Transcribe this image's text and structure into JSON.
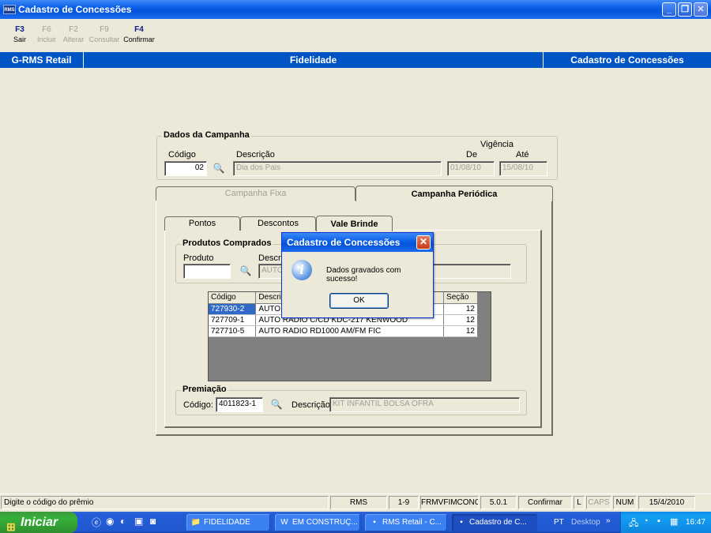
{
  "window": {
    "title": "Cadastro de Concessões",
    "app_icon": "RMS"
  },
  "toolbar": [
    {
      "key": "F3",
      "label": "Sair",
      "enabled": true
    },
    {
      "key": "F6",
      "label": "Incluir",
      "enabled": false
    },
    {
      "key": "F2",
      "label": "Alterar",
      "enabled": false
    },
    {
      "key": "F9",
      "label": "Consultar",
      "enabled": false
    },
    {
      "key": "F4",
      "label": "Confirmar",
      "enabled": true
    }
  ],
  "header": {
    "left": "G-RMS Retail",
    "center": "Fidelidade",
    "right": "Cadastro de Concessões"
  },
  "campanha": {
    "legend": "Dados da Campanha",
    "codigo_label": "Código",
    "codigo_value": "02",
    "descricao_label": "Descrição",
    "descricao_value": "Dia dos Pais",
    "vigencia_label": "Vigência",
    "de_label": "De",
    "de_value": "01/08/10",
    "ate_label": "Até",
    "ate_value": "15/08/10"
  },
  "outer_tabs": {
    "fixa": "Campanha Fixa",
    "periodica": "Campanha Periódica"
  },
  "inner_tabs": {
    "pontos": "Pontos",
    "descontos": "Descontos",
    "vale_brinde": "Vale Brinde"
  },
  "produtos": {
    "legend": "Produtos Comprados",
    "produto_label": "Produto",
    "descricao_label": "Descri",
    "descricao_value": "AUTO",
    "columns": {
      "codigo": "Código",
      "descricao": "Descri",
      "secao": "Seção"
    },
    "rows": [
      {
        "codigo": "727930-2",
        "descricao": "AUTO",
        "secao": "12"
      },
      {
        "codigo": "727709-1",
        "descricao": "AUTO RADIO C/CD KDC-217 KENWOOD",
        "secao": "12"
      },
      {
        "codigo": "727710-5",
        "descricao": "AUTO RADIO RD1000 AM/FM FIC",
        "secao": "12"
      }
    ]
  },
  "premiacao": {
    "legend": "Premiação",
    "codigo_label": "Código:",
    "codigo_value": "4011823-1",
    "descricao_label": "Descrição:",
    "descricao_value": "KIT INFANTIL BOLSA OFRA"
  },
  "dialog": {
    "title": "Cadastro de Concessões",
    "message": "Dados gravados com sucesso!",
    "ok": "OK",
    "icon": "info-icon"
  },
  "status": {
    "hint": "Digite o código do prêmio",
    "system": "RMS",
    "range": "1-9",
    "form": "FRMVFIMCONC",
    "version": "5.0.1",
    "mode": "Confirmar",
    "l": "L",
    "caps": "CAPS",
    "num": "NUM",
    "date": "15/4/2010"
  },
  "taskbar": {
    "start": "Iniciar",
    "tasks": [
      {
        "label": "FIDELIDADE",
        "icon": "folder-icon"
      },
      {
        "label": "EM CONSTRUÇ...",
        "icon": "word-icon"
      },
      {
        "label": "RMS Retail - C...",
        "icon": "rms-icon"
      },
      {
        "label": "Cadastro de C...",
        "icon": "rms-icon"
      }
    ],
    "lang": "PT",
    "desktop": "Desktop",
    "clock": "16:47"
  },
  "colors": {
    "header_band": "#0054c4",
    "selection": "#3169c6",
    "face": "#ece9d8"
  }
}
